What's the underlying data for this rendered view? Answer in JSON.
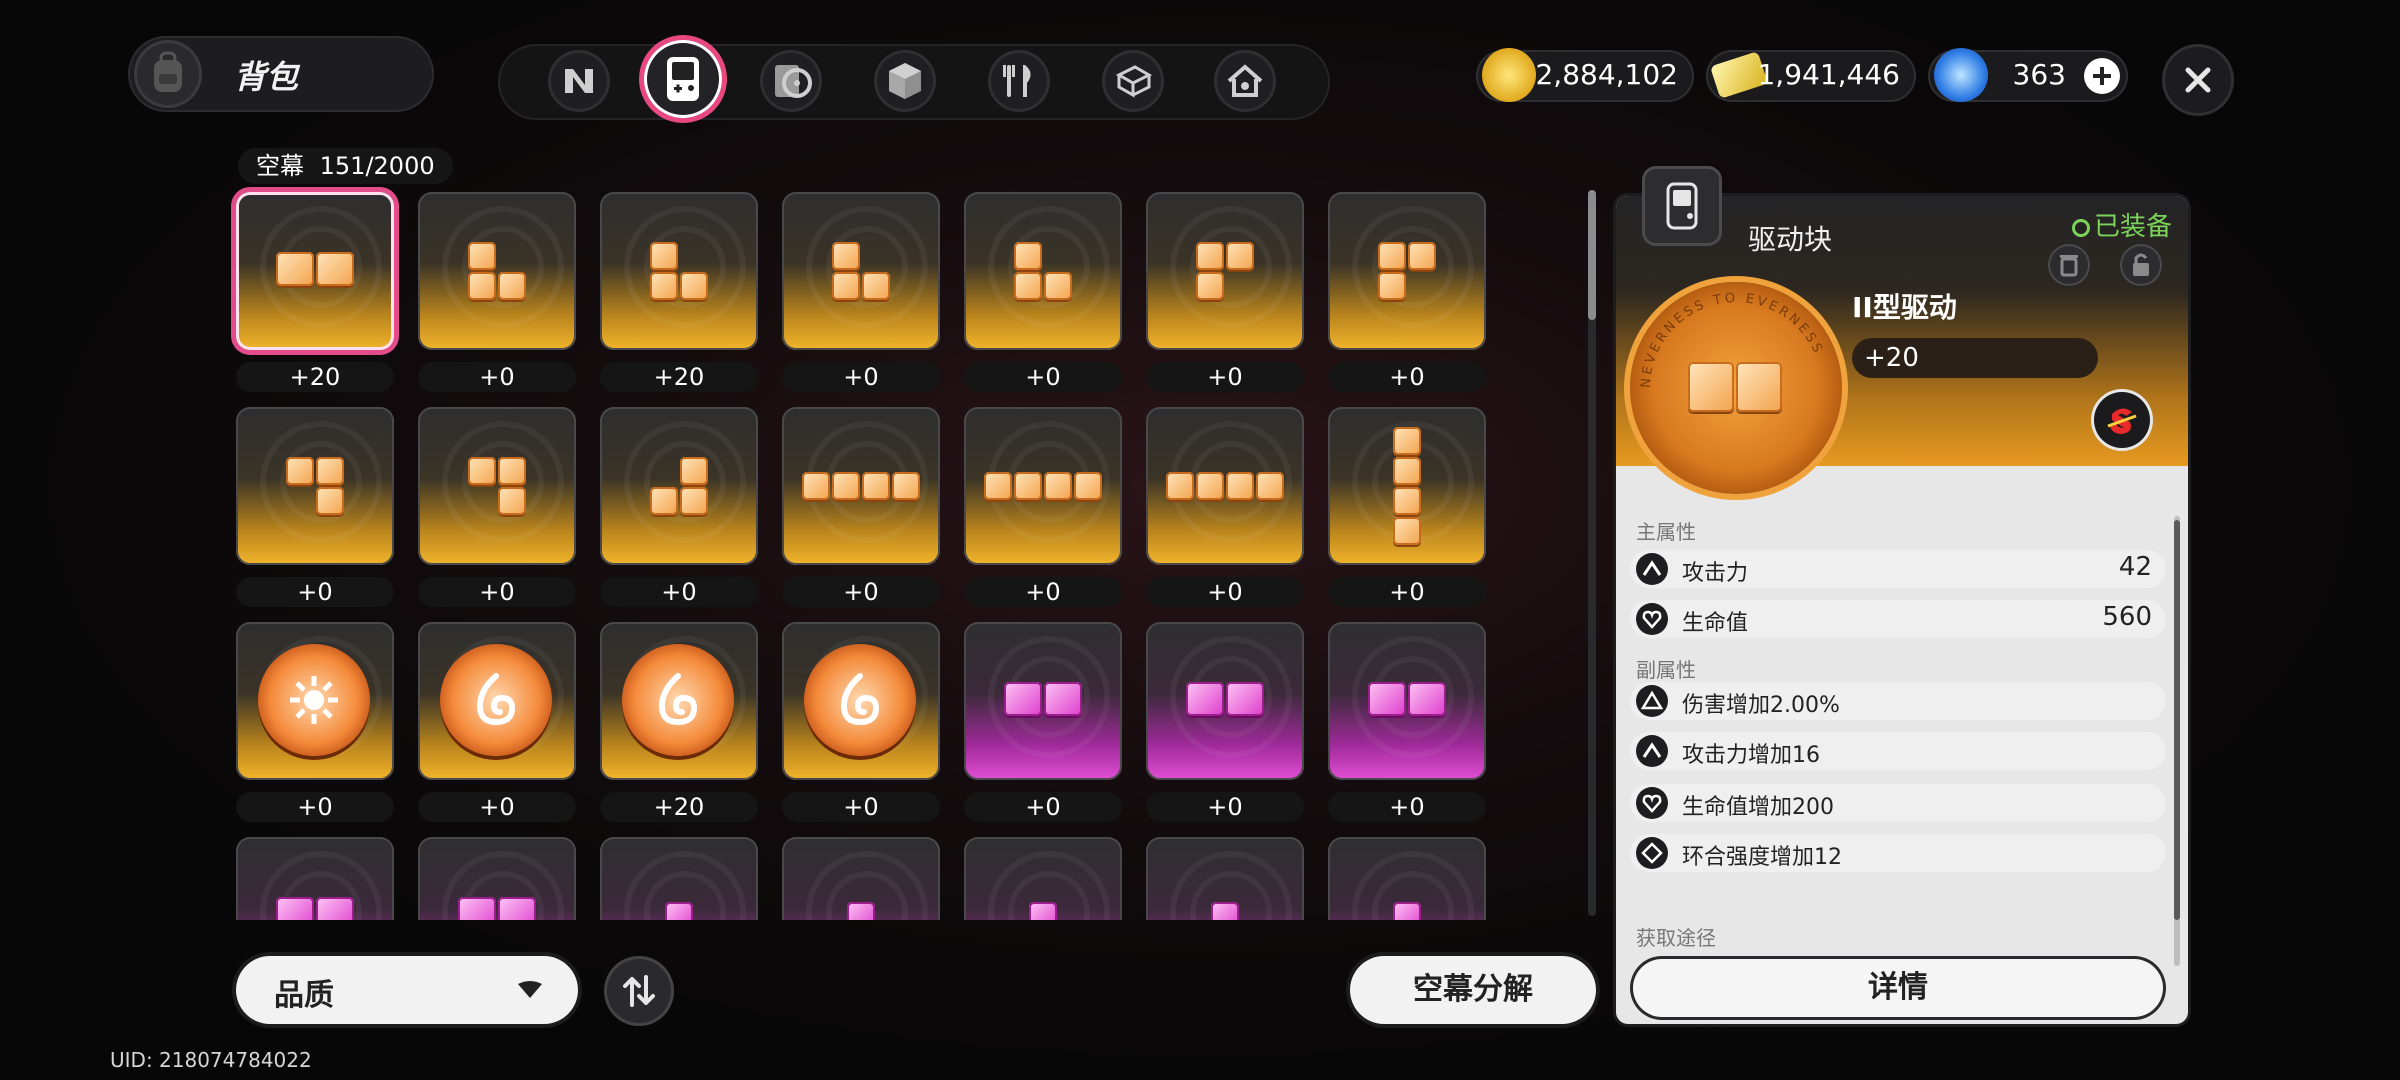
{
  "header": {
    "title": "背包",
    "tabs": [
      {
        "icon": "n-logo-icon",
        "active": false
      },
      {
        "icon": "handheld-console-icon",
        "active": true
      },
      {
        "icon": "record-disc-icon",
        "active": false
      },
      {
        "icon": "cube-icon",
        "active": false
      },
      {
        "icon": "fork-knife-icon",
        "active": false
      },
      {
        "icon": "box-stack-icon",
        "active": false
      },
      {
        "icon": "house-icon",
        "active": false
      }
    ]
  },
  "currencies": {
    "gold": "2,884,102",
    "ticket": "1,941,446",
    "gem": "363"
  },
  "capacity": {
    "label": "空幕",
    "value": "151/2000"
  },
  "grid": {
    "items": [
      {
        "shape": "h2",
        "color": "orange",
        "level": "+20",
        "selected": true
      },
      {
        "shape": "L",
        "color": "orange",
        "level": "+0"
      },
      {
        "shape": "L",
        "color": "orange",
        "level": "+20"
      },
      {
        "shape": "L",
        "color": "orange",
        "level": "+0"
      },
      {
        "shape": "L",
        "color": "orange",
        "level": "+0"
      },
      {
        "shape": "Gamma",
        "color": "orange",
        "level": "+0"
      },
      {
        "shape": "Gamma",
        "color": "orange",
        "level": "+0"
      },
      {
        "shape": "J7",
        "color": "orange",
        "level": "+0"
      },
      {
        "shape": "J7",
        "color": "orange",
        "level": "+0"
      },
      {
        "shape": "J",
        "color": "orange",
        "level": "+0"
      },
      {
        "shape": "h4",
        "color": "orange",
        "level": "+0"
      },
      {
        "shape": "h4",
        "color": "orange",
        "level": "+0"
      },
      {
        "shape": "h4",
        "color": "orange",
        "level": "+0"
      },
      {
        "shape": "v4",
        "color": "orange",
        "level": "+0"
      },
      {
        "shape": "coin-sun",
        "color": "orange",
        "level": "+0"
      },
      {
        "shape": "coin-swirl",
        "color": "orange",
        "level": "+0"
      },
      {
        "shape": "coin-swirl",
        "color": "orange",
        "level": "+20"
      },
      {
        "shape": "coin-swirl",
        "color": "orange",
        "level": "+0"
      },
      {
        "shape": "h2",
        "color": "pink",
        "level": "+0"
      },
      {
        "shape": "h2",
        "color": "pink",
        "level": "+0"
      },
      {
        "shape": "h2",
        "color": "pink",
        "level": "+0"
      },
      {
        "shape": "h2",
        "color": "pink",
        "level": ""
      },
      {
        "shape": "h2",
        "color": "pink",
        "level": ""
      },
      {
        "shape": "single",
        "color": "pink",
        "level": ""
      },
      {
        "shape": "single",
        "color": "pink",
        "level": ""
      },
      {
        "shape": "single",
        "color": "pink",
        "level": ""
      },
      {
        "shape": "single",
        "color": "pink",
        "level": ""
      },
      {
        "shape": "single",
        "color": "pink",
        "level": ""
      }
    ]
  },
  "bottom": {
    "quality_label": "品质",
    "decompose_label": "空幕分解",
    "uid": "UID: 218074784022"
  },
  "detail": {
    "category": "驱动块",
    "equipped": "已装备",
    "name": "II型驱动",
    "level": "+20",
    "coin_text": "NEVERNESS TO EVERNESS",
    "main_label": "主属性",
    "main_stats": [
      {
        "icon": "attack-icon",
        "name": "攻击力",
        "value": "42"
      },
      {
        "icon": "heart-icon",
        "name": "生命值",
        "value": "560"
      }
    ],
    "sub_label": "副属性",
    "sub_stats": [
      {
        "icon": "triangle-icon",
        "name": "伤害增加2.00%"
      },
      {
        "icon": "attack-icon",
        "name": "攻击力增加16"
      },
      {
        "icon": "heart-icon",
        "name": "生命值增加200"
      },
      {
        "icon": "diamond-icon",
        "name": "环合强度增加12"
      }
    ],
    "source_label": "获取途径",
    "detail_button": "详情"
  },
  "colors": {
    "accent_pink": "#e8487f",
    "rarity_orange": "#f3b52c",
    "rarity_pink": "#e34fd6",
    "equipped_green": "#7bd35a"
  }
}
